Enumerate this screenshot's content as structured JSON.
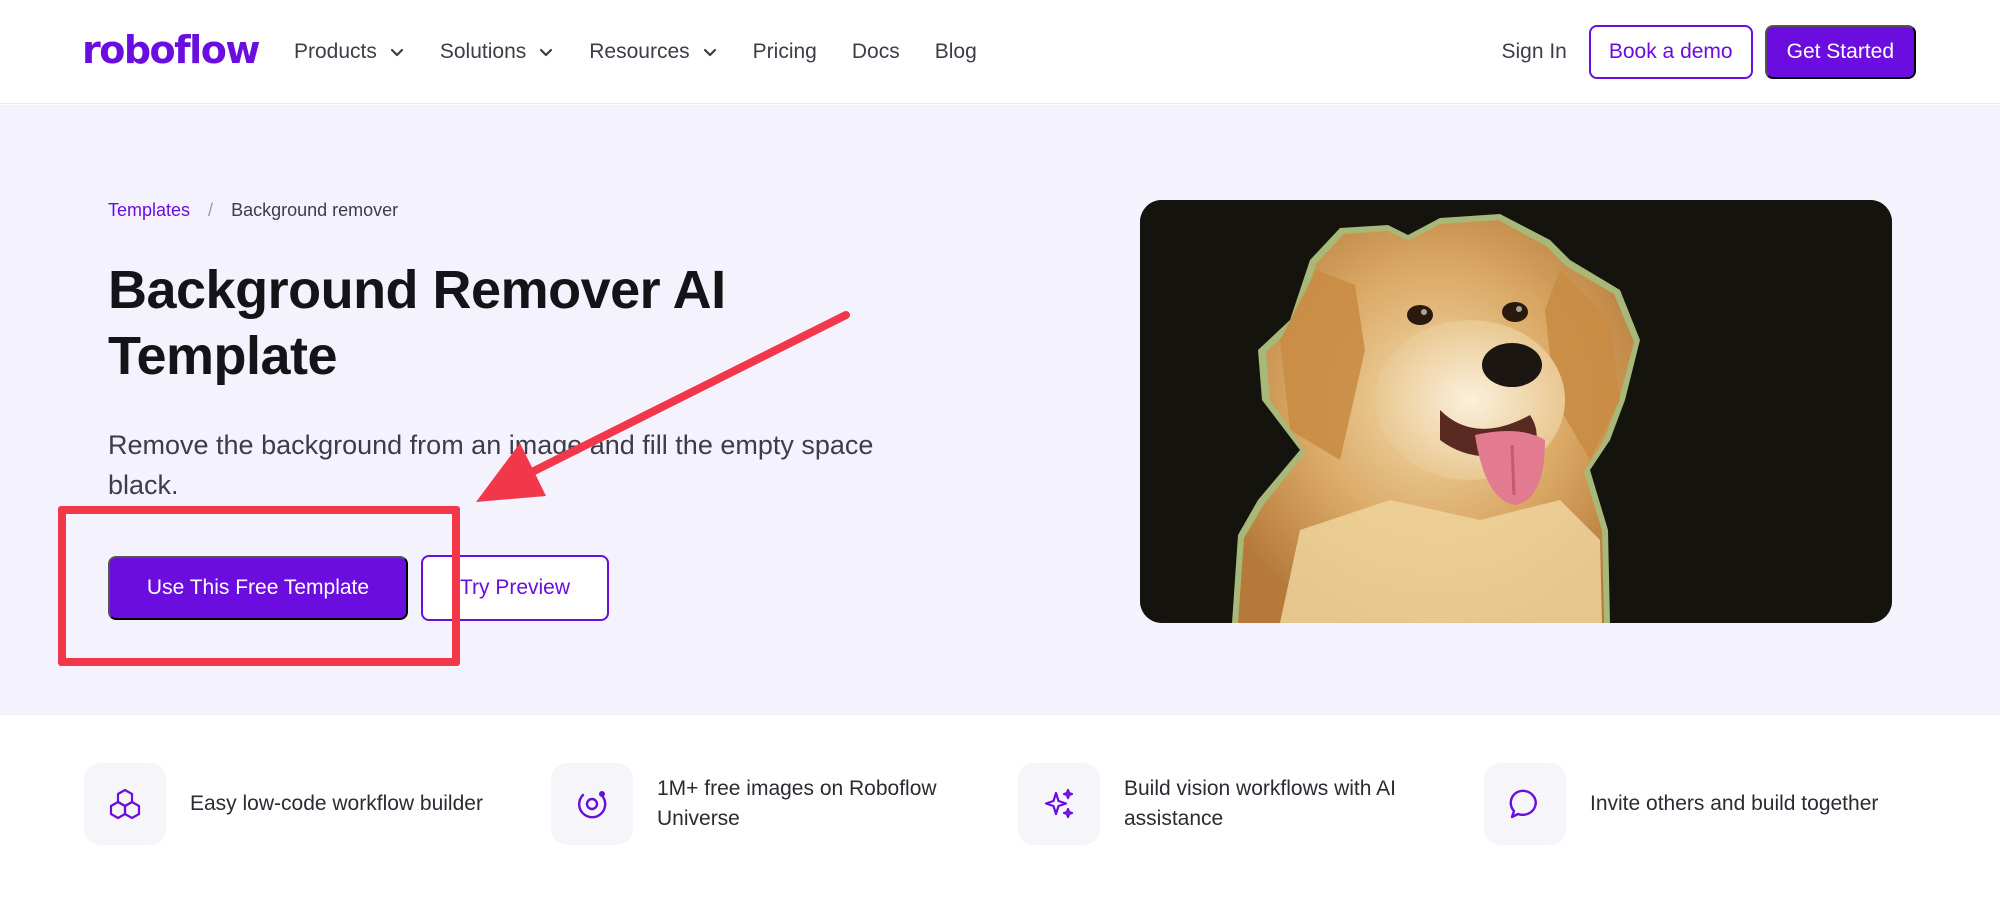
{
  "brand": {
    "logo_text": "roboflow",
    "accent": "#6a0dde"
  },
  "nav": {
    "items": [
      {
        "label": "Products",
        "has_dropdown": true
      },
      {
        "label": "Solutions",
        "has_dropdown": true
      },
      {
        "label": "Resources",
        "has_dropdown": true
      },
      {
        "label": "Pricing",
        "has_dropdown": false
      },
      {
        "label": "Docs",
        "has_dropdown": false
      },
      {
        "label": "Blog",
        "has_dropdown": false
      }
    ],
    "sign_in": "Sign In",
    "book_demo": "Book a demo",
    "get_started": "Get Started"
  },
  "breadcrumb": {
    "parent": "Templates",
    "separator": "/",
    "current": "Background remover"
  },
  "hero": {
    "title": "Background Remover AI Template",
    "subtitle": "Remove the background from an image and fill the empty space black.",
    "primary_button": "Use This Free Template",
    "secondary_button": "Try Preview",
    "image_subject": "golden-retriever-dog"
  },
  "annotation": {
    "color": "#f2374a",
    "shapes": [
      "arrow",
      "box"
    ]
  },
  "features": [
    {
      "icon": "cubes-icon",
      "text": "Easy low-code workflow builder"
    },
    {
      "icon": "universe-icon",
      "text": "1M+ free images on Roboflow Universe"
    },
    {
      "icon": "sparkles-icon",
      "text": "Build vision workflows with AI assistance"
    },
    {
      "icon": "chat-bubble-icon",
      "text": "Invite others and build together"
    }
  ]
}
